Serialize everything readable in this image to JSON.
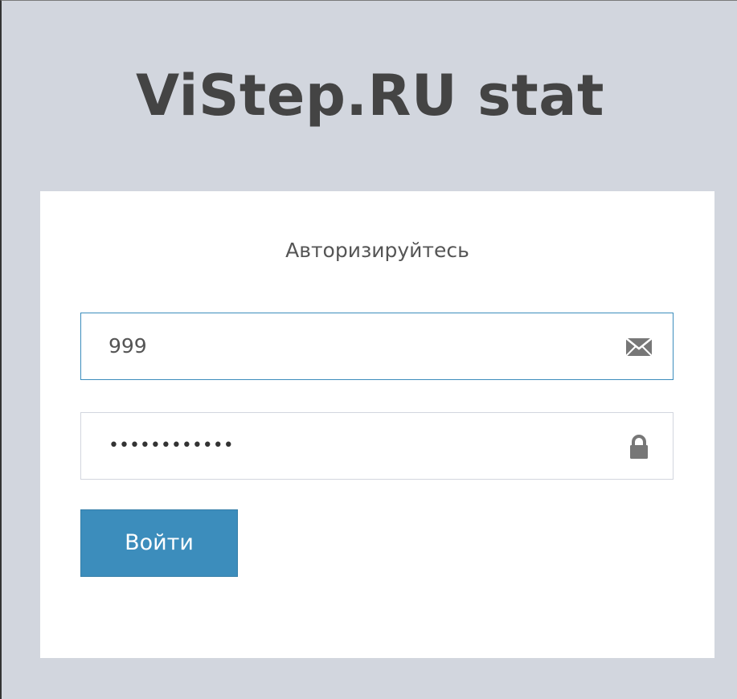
{
  "app": {
    "logo_text": "ViStep.RU stat"
  },
  "login": {
    "message": "Авторизируйтесь",
    "email_field": {
      "value": "999",
      "icon": "envelope-icon"
    },
    "password_field": {
      "value": "••••••••••••",
      "icon": "lock-icon"
    },
    "submit_label": "Войти"
  },
  "colors": {
    "page_background": "#d2d6de",
    "card_background": "#ffffff",
    "logo_text": "#444444",
    "primary_button": "#3c8dbc",
    "focused_border": "#3c8dbc",
    "input_border": "#d2d6de",
    "icon": "#777777"
  }
}
